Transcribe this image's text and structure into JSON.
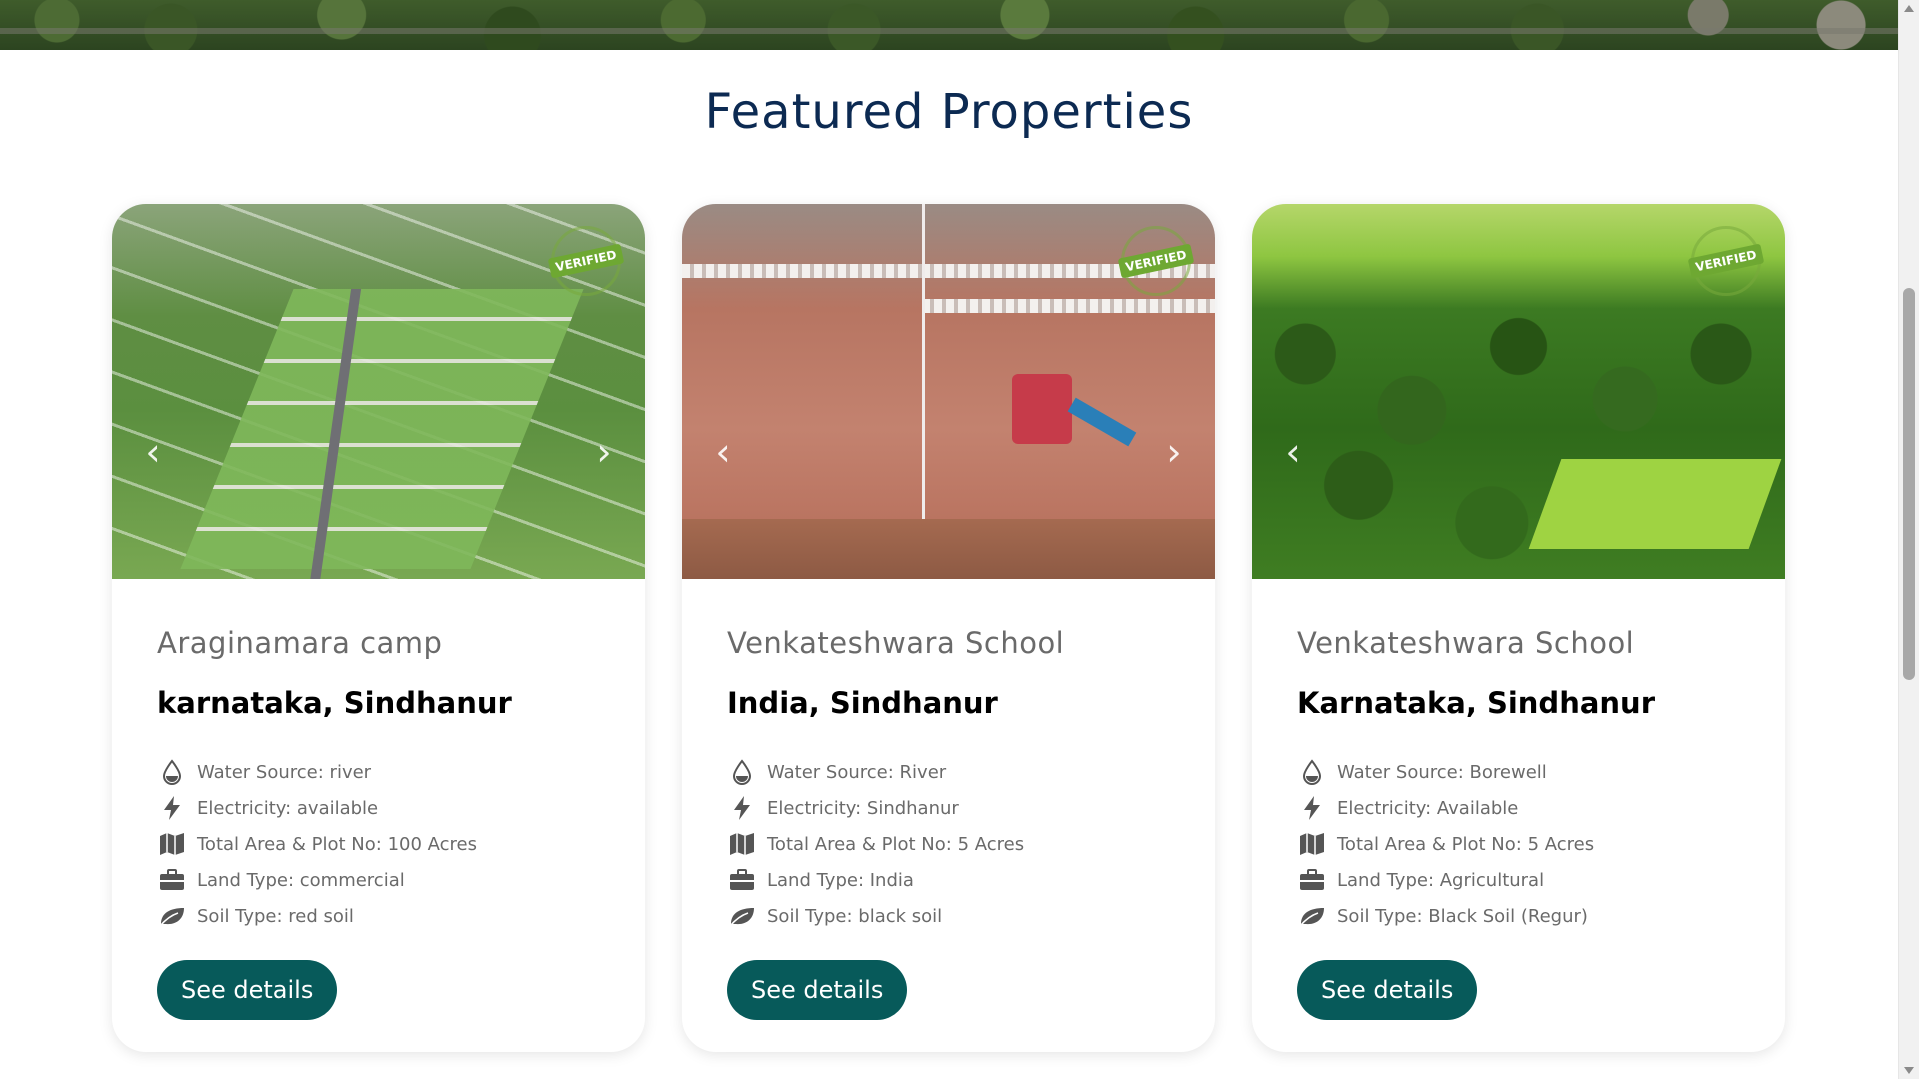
{
  "section_title": "Featured Properties",
  "button_label": "See details",
  "verified_label": "VERIFIED",
  "colors": {
    "title": "#0c2a52",
    "button": "#075a5a",
    "text_muted": "#6a6a6a"
  },
  "cards": [
    {
      "title": "Araginamara camp",
      "location": "karnataka, Sindhanur",
      "features": [
        {
          "icon": "water-drop-icon",
          "text": "Water Source: river"
        },
        {
          "icon": "lightning-icon",
          "text": "Electricity: available"
        },
        {
          "icon": "map-icon",
          "text": "Total Area & Plot No: 100 Acres"
        },
        {
          "icon": "briefcase-icon",
          "text": "Land Type: commercial"
        },
        {
          "icon": "leaf-icon",
          "text": "Soil Type: red soil"
        }
      ]
    },
    {
      "title": "Venkateshwara School",
      "location": "India, Sindhanur",
      "features": [
        {
          "icon": "water-drop-icon",
          "text": "Water Source: River"
        },
        {
          "icon": "lightning-icon",
          "text": "Electricity: Sindhanur"
        },
        {
          "icon": "map-icon",
          "text": "Total Area & Plot No: 5 Acres"
        },
        {
          "icon": "briefcase-icon",
          "text": "Land Type: India"
        },
        {
          "icon": "leaf-icon",
          "text": "Soil Type: black soil"
        }
      ]
    },
    {
      "title": "Venkateshwara School",
      "location": "Karnataka, Sindhanur",
      "features": [
        {
          "icon": "water-drop-icon",
          "text": "Water Source: Borewell"
        },
        {
          "icon": "lightning-icon",
          "text": "Electricity: Available"
        },
        {
          "icon": "map-icon",
          "text": "Total Area & Plot No: 5 Acres"
        },
        {
          "icon": "briefcase-icon",
          "text": "Land Type: Agricultural"
        },
        {
          "icon": "leaf-icon",
          "text": "Soil Type: Black Soil (Regur)"
        }
      ]
    }
  ]
}
